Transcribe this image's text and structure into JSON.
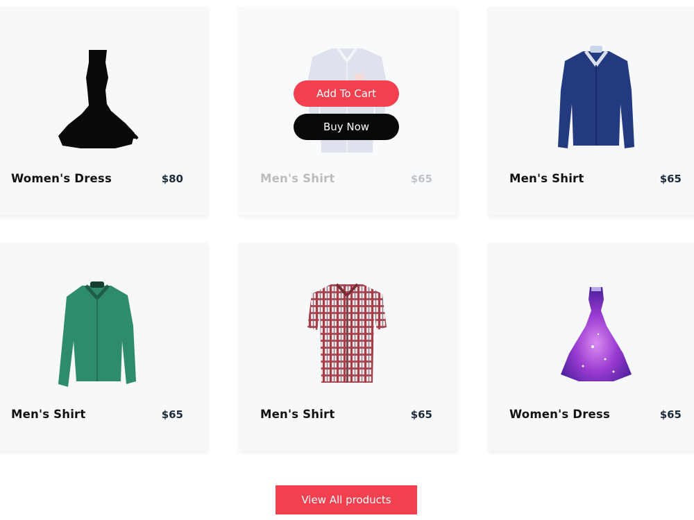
{
  "products": [
    {
      "name": "Women's Dress",
      "price": "$80",
      "icon": "black-dress-icon"
    },
    {
      "name": "Men's Shirt",
      "price": "$65",
      "icon": "grey-shirt-icon"
    },
    {
      "name": "Men's Shirt",
      "price": "$65",
      "icon": "navy-shirt-icon"
    },
    {
      "name": "Men's Shirt",
      "price": "$65",
      "icon": "green-shirt-icon"
    },
    {
      "name": "Men's Shirt",
      "price": "$65",
      "icon": "plaid-shirt-icon"
    },
    {
      "name": "Women's Dress",
      "price": "$65",
      "icon": "purple-dress-icon"
    }
  ],
  "overlay": {
    "add_to_cart": "Add To Cart",
    "buy_now": "Buy Now"
  },
  "view_all_label": "View All products",
  "colors": {
    "accent": "#f2404f",
    "dark_button": "#080808",
    "card_bg": "#f7f8fa"
  }
}
